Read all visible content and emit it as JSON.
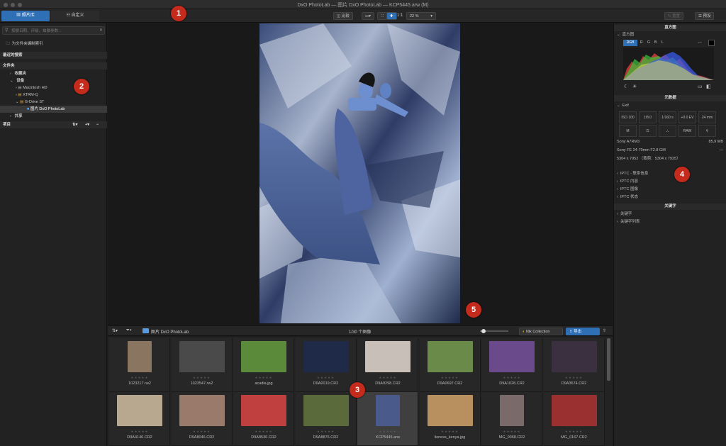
{
  "window": {
    "title": "DxO PhotoLab — 图片 DxO PhotoLab — KCP5445.arw (M)"
  },
  "toolbar": {
    "tab_library": "照片库",
    "tab_customize": "自定义",
    "compare": "比较",
    "zoom_1to1": "1:1",
    "zoom_level": "22 %",
    "reset": "重置",
    "preset": "预设"
  },
  "left": {
    "search_placeholder": "按摄日期、评级、拍摄参数...",
    "index_folder": "为文件夹编制索引",
    "recent_searches": "最近的搜索",
    "folders": "文件夹",
    "favorites": "收藏夹",
    "devices": "设备",
    "drive1": "Macintosh HD",
    "drive2": "XTRM-Q",
    "drive3": "G-Drive ST",
    "folder_selected": "图片 DxO PhotoLab",
    "shared": "共享",
    "projects": "项目"
  },
  "right": {
    "histogram_title": "直方图",
    "histogram_label": "直方图",
    "channels": [
      "RGB",
      "R",
      "G",
      "B",
      "L"
    ],
    "metadata_title": "元数据",
    "exif_label": "Exif",
    "exif_row1": [
      "ISO 100",
      "ƒ/8.0",
      "1/160 s",
      "+0.0 EV",
      "24 mm"
    ],
    "exif_row2": [
      "M",
      "☲",
      "⛬",
      "RAW",
      "⚲"
    ],
    "camera": "Sony A7RM3",
    "file_size": "85,9 MB",
    "lens": "Sony FE 24-70mm F2.8 GM",
    "lens_extra": "—",
    "dimensions": "5304 x 7952 （裁剪：5304 x 7925）",
    "iptc_contact": "IPTC - 联系信息",
    "iptc_content": "IPTC 内容",
    "iptc_image": "IPTC 图像",
    "iptc_status": "IPTC 状态",
    "keywords_title": "关键字",
    "keywords": "关键字",
    "keyword_list": "关键字列表"
  },
  "filmstrip": {
    "folder": "图片 DxO PhotoLab",
    "count": "1/30 个图像",
    "nik": "Nik Collection",
    "export": "导出",
    "stars": "★★★★★",
    "images": [
      {
        "name": "1023217.rw2",
        "color": "#8a7660"
      },
      {
        "name": "1023547.rw2",
        "color": "#4a4a4a"
      },
      {
        "name": "acadia.jpg",
        "color": "#5a8a3a"
      },
      {
        "name": "D9A0019.CR2",
        "color": "#1e2a48"
      },
      {
        "name": "D9A0298.CR2",
        "color": "#c8c0b8"
      },
      {
        "name": "D9A0697.CR2",
        "color": "#6a8a4a"
      },
      {
        "name": "D9A1028.CR2",
        "color": "#6a4a8a"
      },
      {
        "name": "D9A3674.CR2",
        "color": "#3a3040"
      },
      {
        "name": "D9A4146.CR2",
        "color": "#b8a890"
      },
      {
        "name": "D9A8046.CR2",
        "color": "#9a7a6a"
      },
      {
        "name": "D9A8536.CR2",
        "color": "#c04040"
      },
      {
        "name": "D9A8876.CR2",
        "color": "#5a6a3a"
      },
      {
        "name": "KCP5445.arw",
        "color": "#4a5a8a"
      },
      {
        "name": "lioness_kenya.jpg",
        "color": "#b89060"
      },
      {
        "name": "MG_0068.CR2",
        "color": "#7a6a6a"
      },
      {
        "name": "MG_0167.CR2",
        "color": "#9a3030"
      }
    ]
  },
  "badges": {
    "b1": "1",
    "b2": "2",
    "b3": "3",
    "b4": "4",
    "b5": "5"
  },
  "colors": {
    "accent": "#2f6fb6",
    "badge": "#c42b1c"
  }
}
